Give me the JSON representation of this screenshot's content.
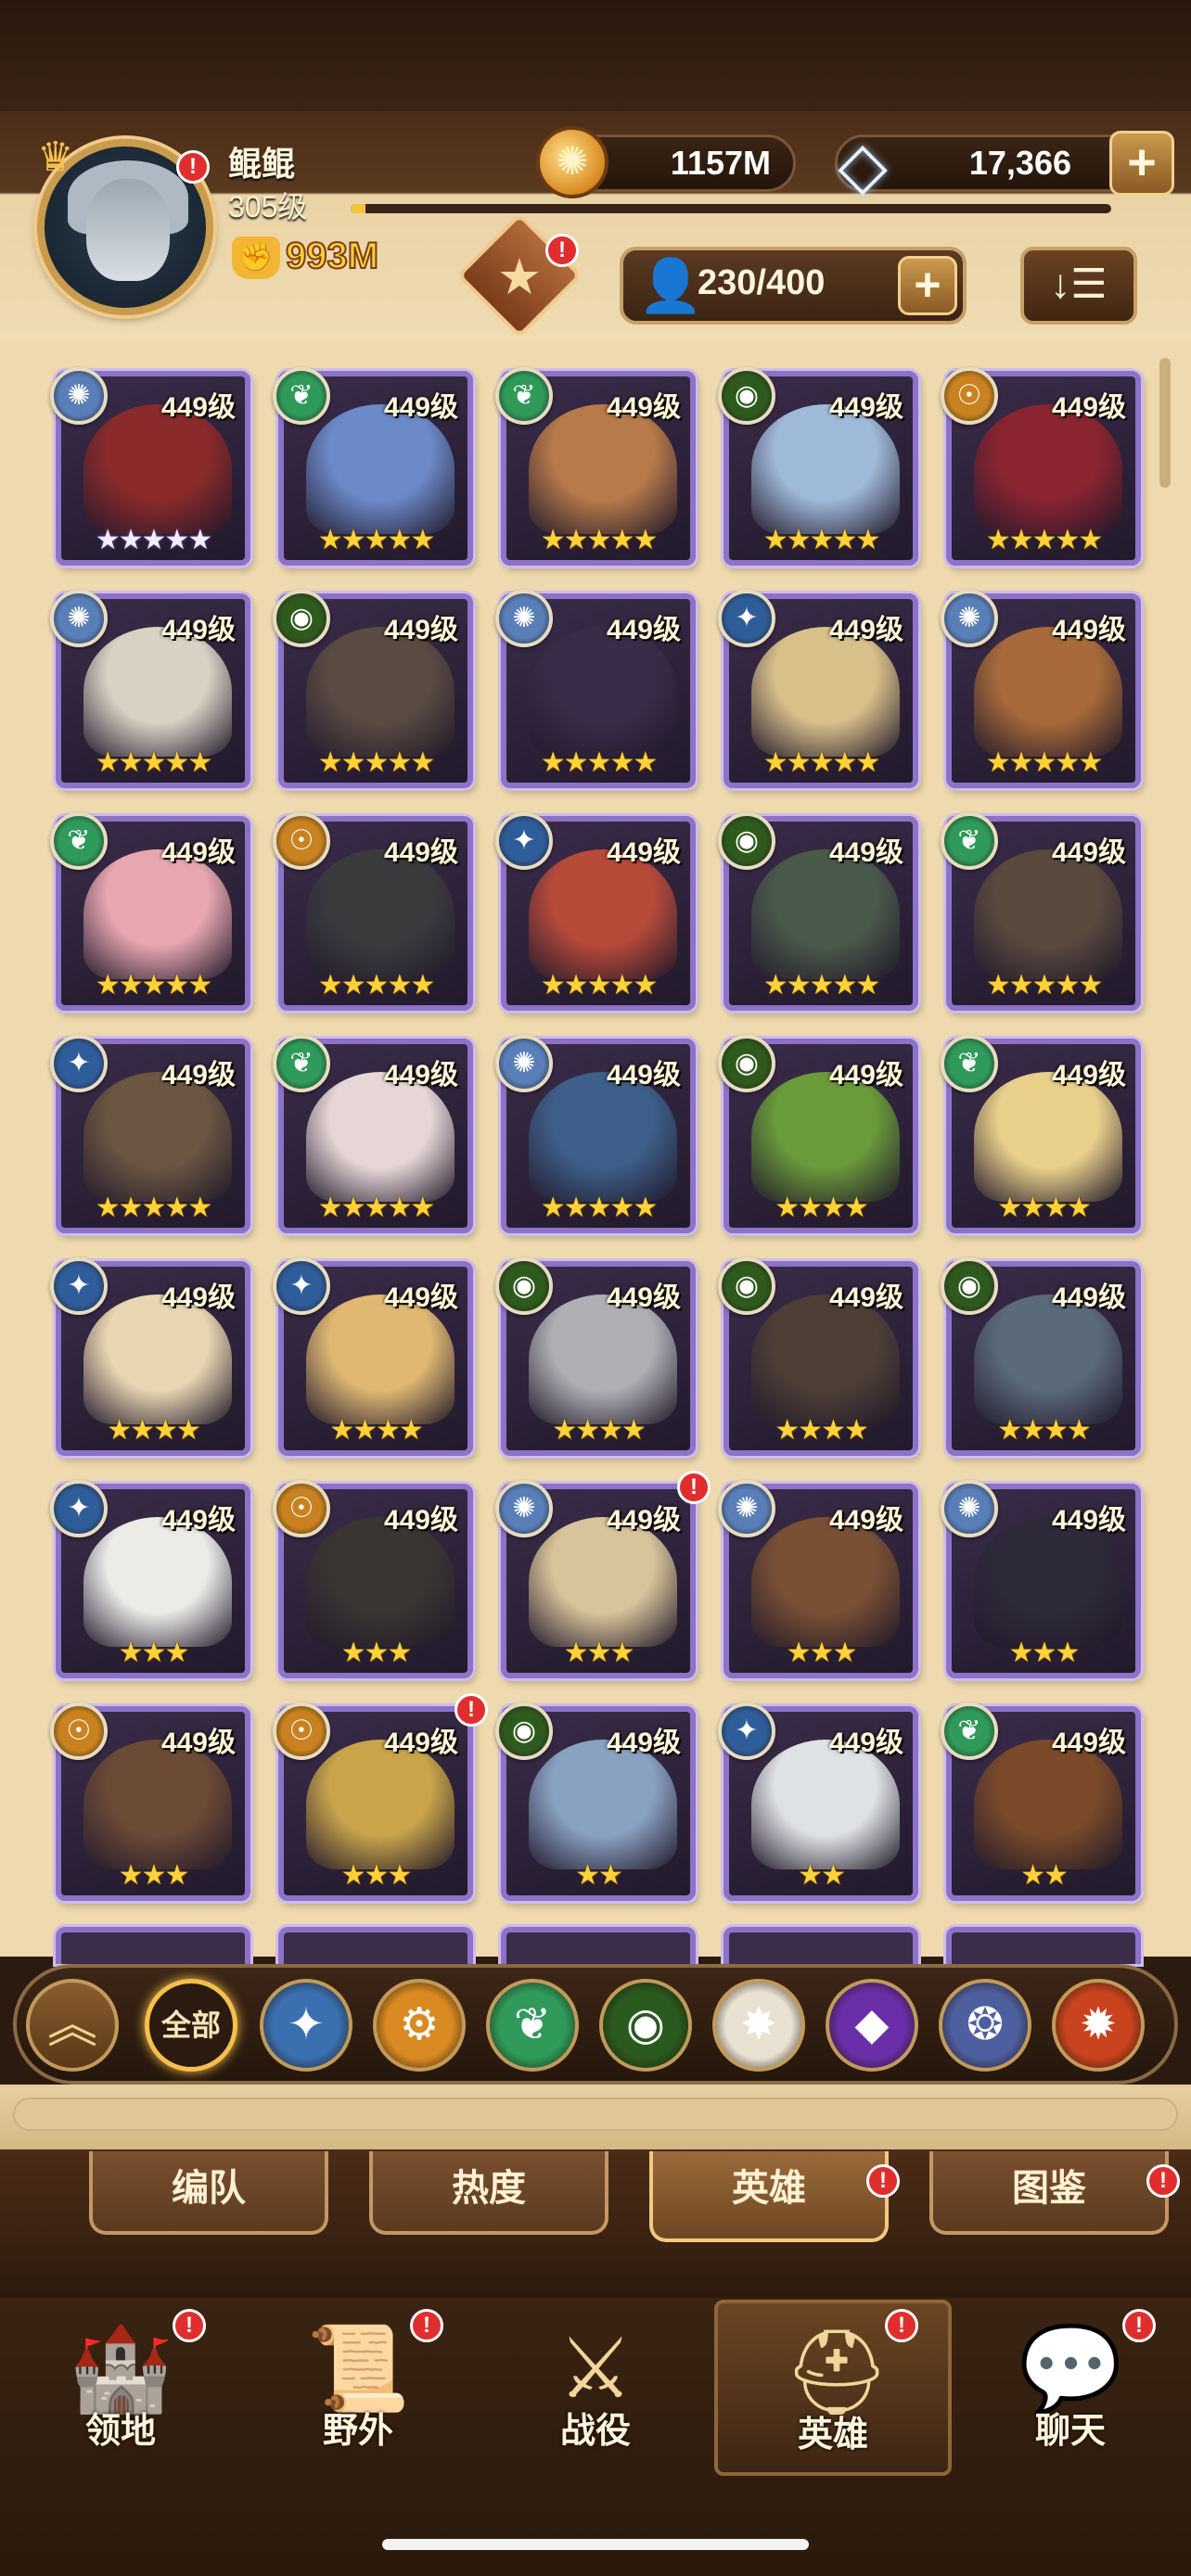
{
  "player": {
    "name": "鲲鲲",
    "level": "305级",
    "exp_fraction": 0.02,
    "power": "993M"
  },
  "currency": {
    "gold": "1157M",
    "gems": "17,366",
    "add_label": "+"
  },
  "roster": {
    "value": "230/400",
    "add_label": "+",
    "sort_label": "↓☰"
  },
  "badges": {
    "mark": "!"
  },
  "heroes": [
    {
      "level": "449级",
      "stars": "★★★★★",
      "star_style": "white",
      "faction": "celestial",
      "portrait": "#8b2a2a"
    },
    {
      "level": "449级",
      "stars": "★★★★★",
      "star_style": "gold",
      "faction": "wilder",
      "portrait": "#6c8ac9"
    },
    {
      "level": "449级",
      "stars": "★★★★★",
      "star_style": "gold",
      "faction": "wilder",
      "portrait": "#b77a4a"
    },
    {
      "level": "449级",
      "stars": "★★★★★",
      "star_style": "gold",
      "faction": "graveborn",
      "portrait": "#9fb9d8"
    },
    {
      "level": "449级",
      "stars": "★★★★★",
      "star_style": "gold",
      "faction": "mauler",
      "portrait": "#8a2430"
    },
    {
      "level": "449级",
      "stars": "★★★★★",
      "star_style": "gold",
      "faction": "celestial",
      "portrait": "#d8d2c4"
    },
    {
      "level": "449级",
      "stars": "★★★★★",
      "star_style": "gold",
      "faction": "graveborn",
      "portrait": "#5a4b42"
    },
    {
      "level": "449级",
      "stars": "★★★★★",
      "star_style": "gold",
      "faction": "celestial",
      "portrait": "#3a2c48"
    },
    {
      "level": "449级",
      "stars": "★★★★★",
      "star_style": "gold",
      "faction": "lightbearer",
      "portrait": "#d8c08a"
    },
    {
      "level": "449级",
      "stars": "★★★★★",
      "star_style": "gold",
      "faction": "celestial",
      "portrait": "#a86a3a"
    },
    {
      "level": "449级",
      "stars": "★★★★★",
      "star_style": "gold",
      "faction": "wilder",
      "portrait": "#e8a6b0"
    },
    {
      "level": "449级",
      "stars": "★★★★★",
      "star_style": "gold",
      "faction": "mauler",
      "portrait": "#3b3b3e"
    },
    {
      "level": "449级",
      "stars": "★★★★★",
      "star_style": "gold",
      "faction": "lightbearer",
      "portrait": "#b84a3a"
    },
    {
      "level": "449级",
      "stars": "★★★★★",
      "star_style": "gold",
      "faction": "graveborn",
      "portrait": "#4a5a4a"
    },
    {
      "level": "449级",
      "stars": "★★★★★",
      "star_style": "gold",
      "faction": "wilder",
      "portrait": "#5a4a3e"
    },
    {
      "level": "449级",
      "stars": "★★★★★",
      "star_style": "gold",
      "faction": "lightbearer",
      "portrait": "#6a5642"
    },
    {
      "level": "449级",
      "stars": "★★★★★",
      "star_style": "gold",
      "faction": "wilder",
      "portrait": "#e6d6d6"
    },
    {
      "level": "449级",
      "stars": "★★★★★",
      "star_style": "gold",
      "faction": "celestial",
      "portrait": "#3e5f8a"
    },
    {
      "level": "449级",
      "stars": "★★★★",
      "star_style": "gold",
      "faction": "graveborn",
      "portrait": "#6a9a3a"
    },
    {
      "level": "449级",
      "stars": "★★★★",
      "star_style": "gold",
      "faction": "wilder",
      "portrait": "#e8cf8a"
    },
    {
      "level": "449级",
      "stars": "★★★★",
      "star_style": "gold",
      "faction": "lightbearer",
      "portrait": "#e8d6b2"
    },
    {
      "level": "449级",
      "stars": "★★★★",
      "star_style": "gold",
      "faction": "lightbearer",
      "portrait": "#e0b872"
    },
    {
      "level": "449级",
      "stars": "★★★★",
      "star_style": "gold",
      "faction": "graveborn",
      "portrait": "#b0b0b4"
    },
    {
      "level": "449级",
      "stars": "★★★★",
      "star_style": "gold",
      "faction": "graveborn",
      "portrait": "#4e3f36"
    },
    {
      "level": "449级",
      "stars": "★★★★",
      "star_style": "gold",
      "faction": "graveborn",
      "portrait": "#5a6a7a"
    },
    {
      "level": "449级",
      "stars": "★★★",
      "star_style": "gold",
      "faction": "lightbearer",
      "portrait": "#ecebe8"
    },
    {
      "level": "449级",
      "stars": "★★★",
      "star_style": "gold",
      "faction": "mauler",
      "portrait": "#3a3532"
    },
    {
      "level": "449级",
      "stars": "★★★",
      "star_style": "gold",
      "faction": "celestial",
      "portrait": "#d8c49a"
    },
    {
      "level": "449级",
      "stars": "★★★",
      "star_style": "gold",
      "faction": "celestial",
      "portrait": "#7a5034"
    },
    {
      "level": "449级",
      "stars": "★★★",
      "star_style": "gold",
      "faction": "celestial",
      "portrait": "#2e2a3a"
    },
    {
      "level": "449级",
      "stars": "★★★",
      "star_style": "gold",
      "faction": "mauler",
      "portrait": "#6b4a36"
    },
    {
      "level": "449级",
      "stars": "★★★",
      "star_style": "gold",
      "faction": "mauler",
      "portrait": "#c9a44a"
    },
    {
      "level": "449级",
      "stars": "★★",
      "star_style": "gold",
      "faction": "graveborn",
      "portrait": "#8aa2c2"
    },
    {
      "level": "449级",
      "stars": "★★",
      "star_style": "gold",
      "faction": "lightbearer",
      "portrait": "#dfe2e4"
    },
    {
      "level": "449级",
      "stars": "★★",
      "star_style": "gold",
      "faction": "wilder",
      "portrait": "#7a4a2a"
    }
  ],
  "hero_badge_indices": [
    27,
    31
  ],
  "faction_filters": {
    "collapse_label": "︽",
    "all_label": "全部",
    "items": [
      {
        "name": "lightbearer",
        "glyph": "✦",
        "color": "#3b6fb0"
      },
      {
        "name": "mauler",
        "glyph": "⚙",
        "color": "#d98a22"
      },
      {
        "name": "wilder",
        "glyph": "❦",
        "color": "#2f9a5a"
      },
      {
        "name": "graveborn",
        "glyph": "◉",
        "color": "#2a5a1e"
      },
      {
        "name": "celestial",
        "glyph": "✸",
        "color": "#e9e2d2"
      },
      {
        "name": "hypogean",
        "glyph": "◆",
        "color": "#6a2fa8"
      },
      {
        "name": "dimensional",
        "glyph": "❂",
        "color": "#4e5fa0"
      },
      {
        "name": "draconis",
        "glyph": "✹",
        "color": "#c8431e"
      }
    ]
  },
  "sub_tabs": [
    {
      "label": "编队",
      "active": false
    },
    {
      "label": "热度",
      "active": false
    },
    {
      "label": "英雄",
      "active": true
    },
    {
      "label": "图鉴",
      "active": false
    }
  ],
  "nav": [
    {
      "label": "领地",
      "icon": "castle-icon"
    },
    {
      "label": "野外",
      "icon": "scroll-map-icon"
    },
    {
      "label": "战役",
      "icon": "sword-shield-icon"
    },
    {
      "label": "英雄",
      "icon": "helmet-icon"
    },
    {
      "label": "聊天",
      "icon": "chat-bubble-icon"
    }
  ],
  "faction_colors": {
    "lightbearer": "#2f5d9a",
    "mauler": "#c9821f",
    "wilder": "#2f9a5a",
    "graveborn": "#2f5a1e",
    "celestial": "#5a7fb8",
    "hypogean": "#6a2fa8"
  }
}
